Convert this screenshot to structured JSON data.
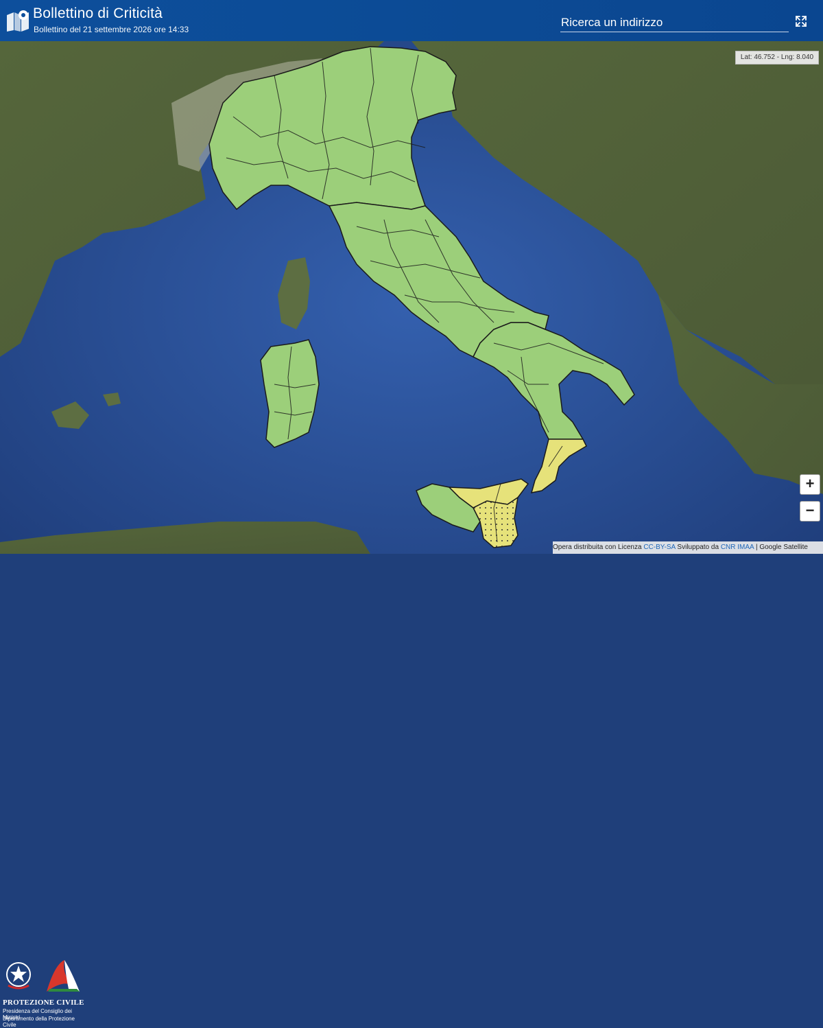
{
  "header": {
    "title": "Bollettino di Criticità",
    "subtitle": "Bollettino del 21 settembre 2026 ore 14:33",
    "search_placeholder": "Ricerca un indirizzo"
  },
  "map": {
    "coords_readout": "Lat: 46.752 - Lng: 8.040",
    "zoom_in_label": "+",
    "zoom_out_label": "−",
    "colors": {
      "sea": "#2a4f9a",
      "land": "#5b6b3f",
      "green_alert": "#9ccf7a",
      "yellow_alert": "#e6e27a",
      "border": "#1a1a1a"
    }
  },
  "attribution": {
    "text_prefix": "Opera distribuita con Licenza",
    "license_link": "CC-BY-SA",
    "developed_by": "Sviluppato da",
    "developer_link": "CNR IMAA",
    "separator": "|",
    "imagery": "Google Satellite"
  },
  "branding": {
    "name": "PROTEZIONE CIVILE",
    "line1": "Presidenza del Consiglio dei Ministri",
    "line2": "Dipartimento della Protezione Civile"
  },
  "icons": {
    "app_logo": "map-pin-icon",
    "fullscreen": "fullscreen-icon"
  }
}
